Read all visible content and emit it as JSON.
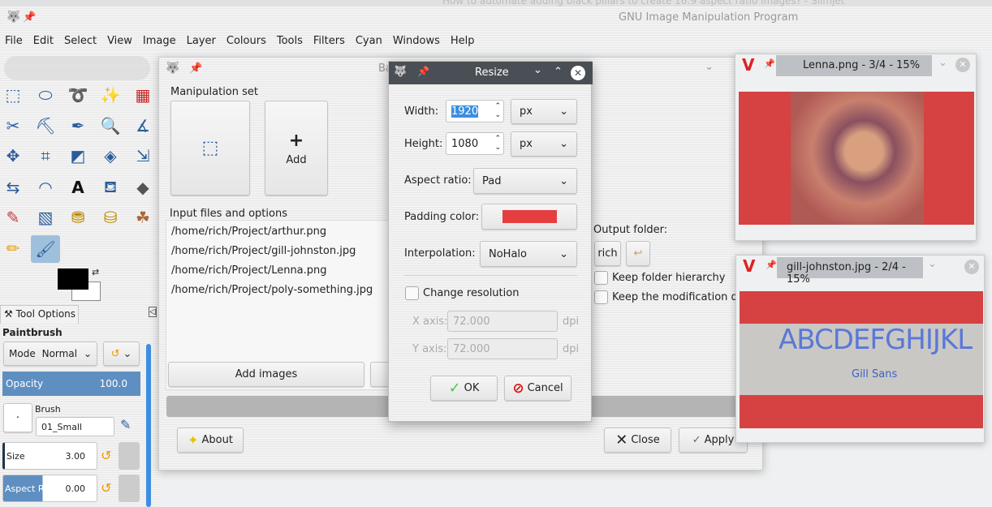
{
  "browser_title": "How to automate adding black pillars to create 16:9 aspect ratio images? - Slimjet",
  "window_title": "GNU Image Manipulation Program",
  "menu": [
    "File",
    "Edit",
    "Select",
    "View",
    "Image",
    "Layer",
    "Colours",
    "Tools",
    "Filters",
    "Cyan",
    "Windows",
    "Help"
  ],
  "tool_options": {
    "tab": "Tool Options",
    "tool": "Paintbrush",
    "mode_label": "Mode",
    "mode_value": "Normal",
    "opacity_label": "Opacity",
    "opacity_value": "100.0",
    "brush_label": "Brush",
    "brush_value": "01_Small",
    "size_label": "Size",
    "size_value": "3.00",
    "aspect_label": "Aspect Ratio",
    "aspect_value": "0.00"
  },
  "batch": {
    "title": "Ba",
    "manipulation_set": "Manipulation set",
    "add_label": "Add",
    "input_files_label": "Input files and options",
    "files": [
      "/home/rich/Project/arthur.png",
      "/home/rich/Project/gill-johnston.jpg",
      "/home/rich/Project/Lenna.png",
      "/home/rich/Project/poly-something.jpg"
    ],
    "add_images": "Add images",
    "output_folder_label": "Output folder:",
    "output_folder": "rich",
    "keep_hierarchy": "Keep folder hierarchy",
    "keep_modification": "Keep the modification da",
    "about": "About",
    "close": "Close",
    "apply": "Apply"
  },
  "resize": {
    "title": "Resize",
    "width_label": "Width:",
    "width_value": "1920",
    "width_unit": "px",
    "height_label": "Height:",
    "height_value": "1080",
    "height_unit": "px",
    "aspect_label": "Aspect ratio:",
    "aspect_value": "Pad",
    "padding_label": "Padding color:",
    "padding_color": "#e53e3e",
    "interp_label": "Interpolation:",
    "interp_value": "NoHalo",
    "change_res": "Change resolution",
    "x_label": "X axis:",
    "x_value": "72.000",
    "y_label": "Y axis:",
    "y_value": "72.000",
    "dpi": "dpi",
    "ok": "OK",
    "cancel": "Cancel"
  },
  "previews": [
    {
      "title": "Lenna.png - 3/4 - 15%"
    },
    {
      "title": "gill-johnston.jpg - 2/4 - 15%",
      "text_big": "ABCDEFGHIJKL",
      "text_small": "Gill Sans"
    }
  ]
}
